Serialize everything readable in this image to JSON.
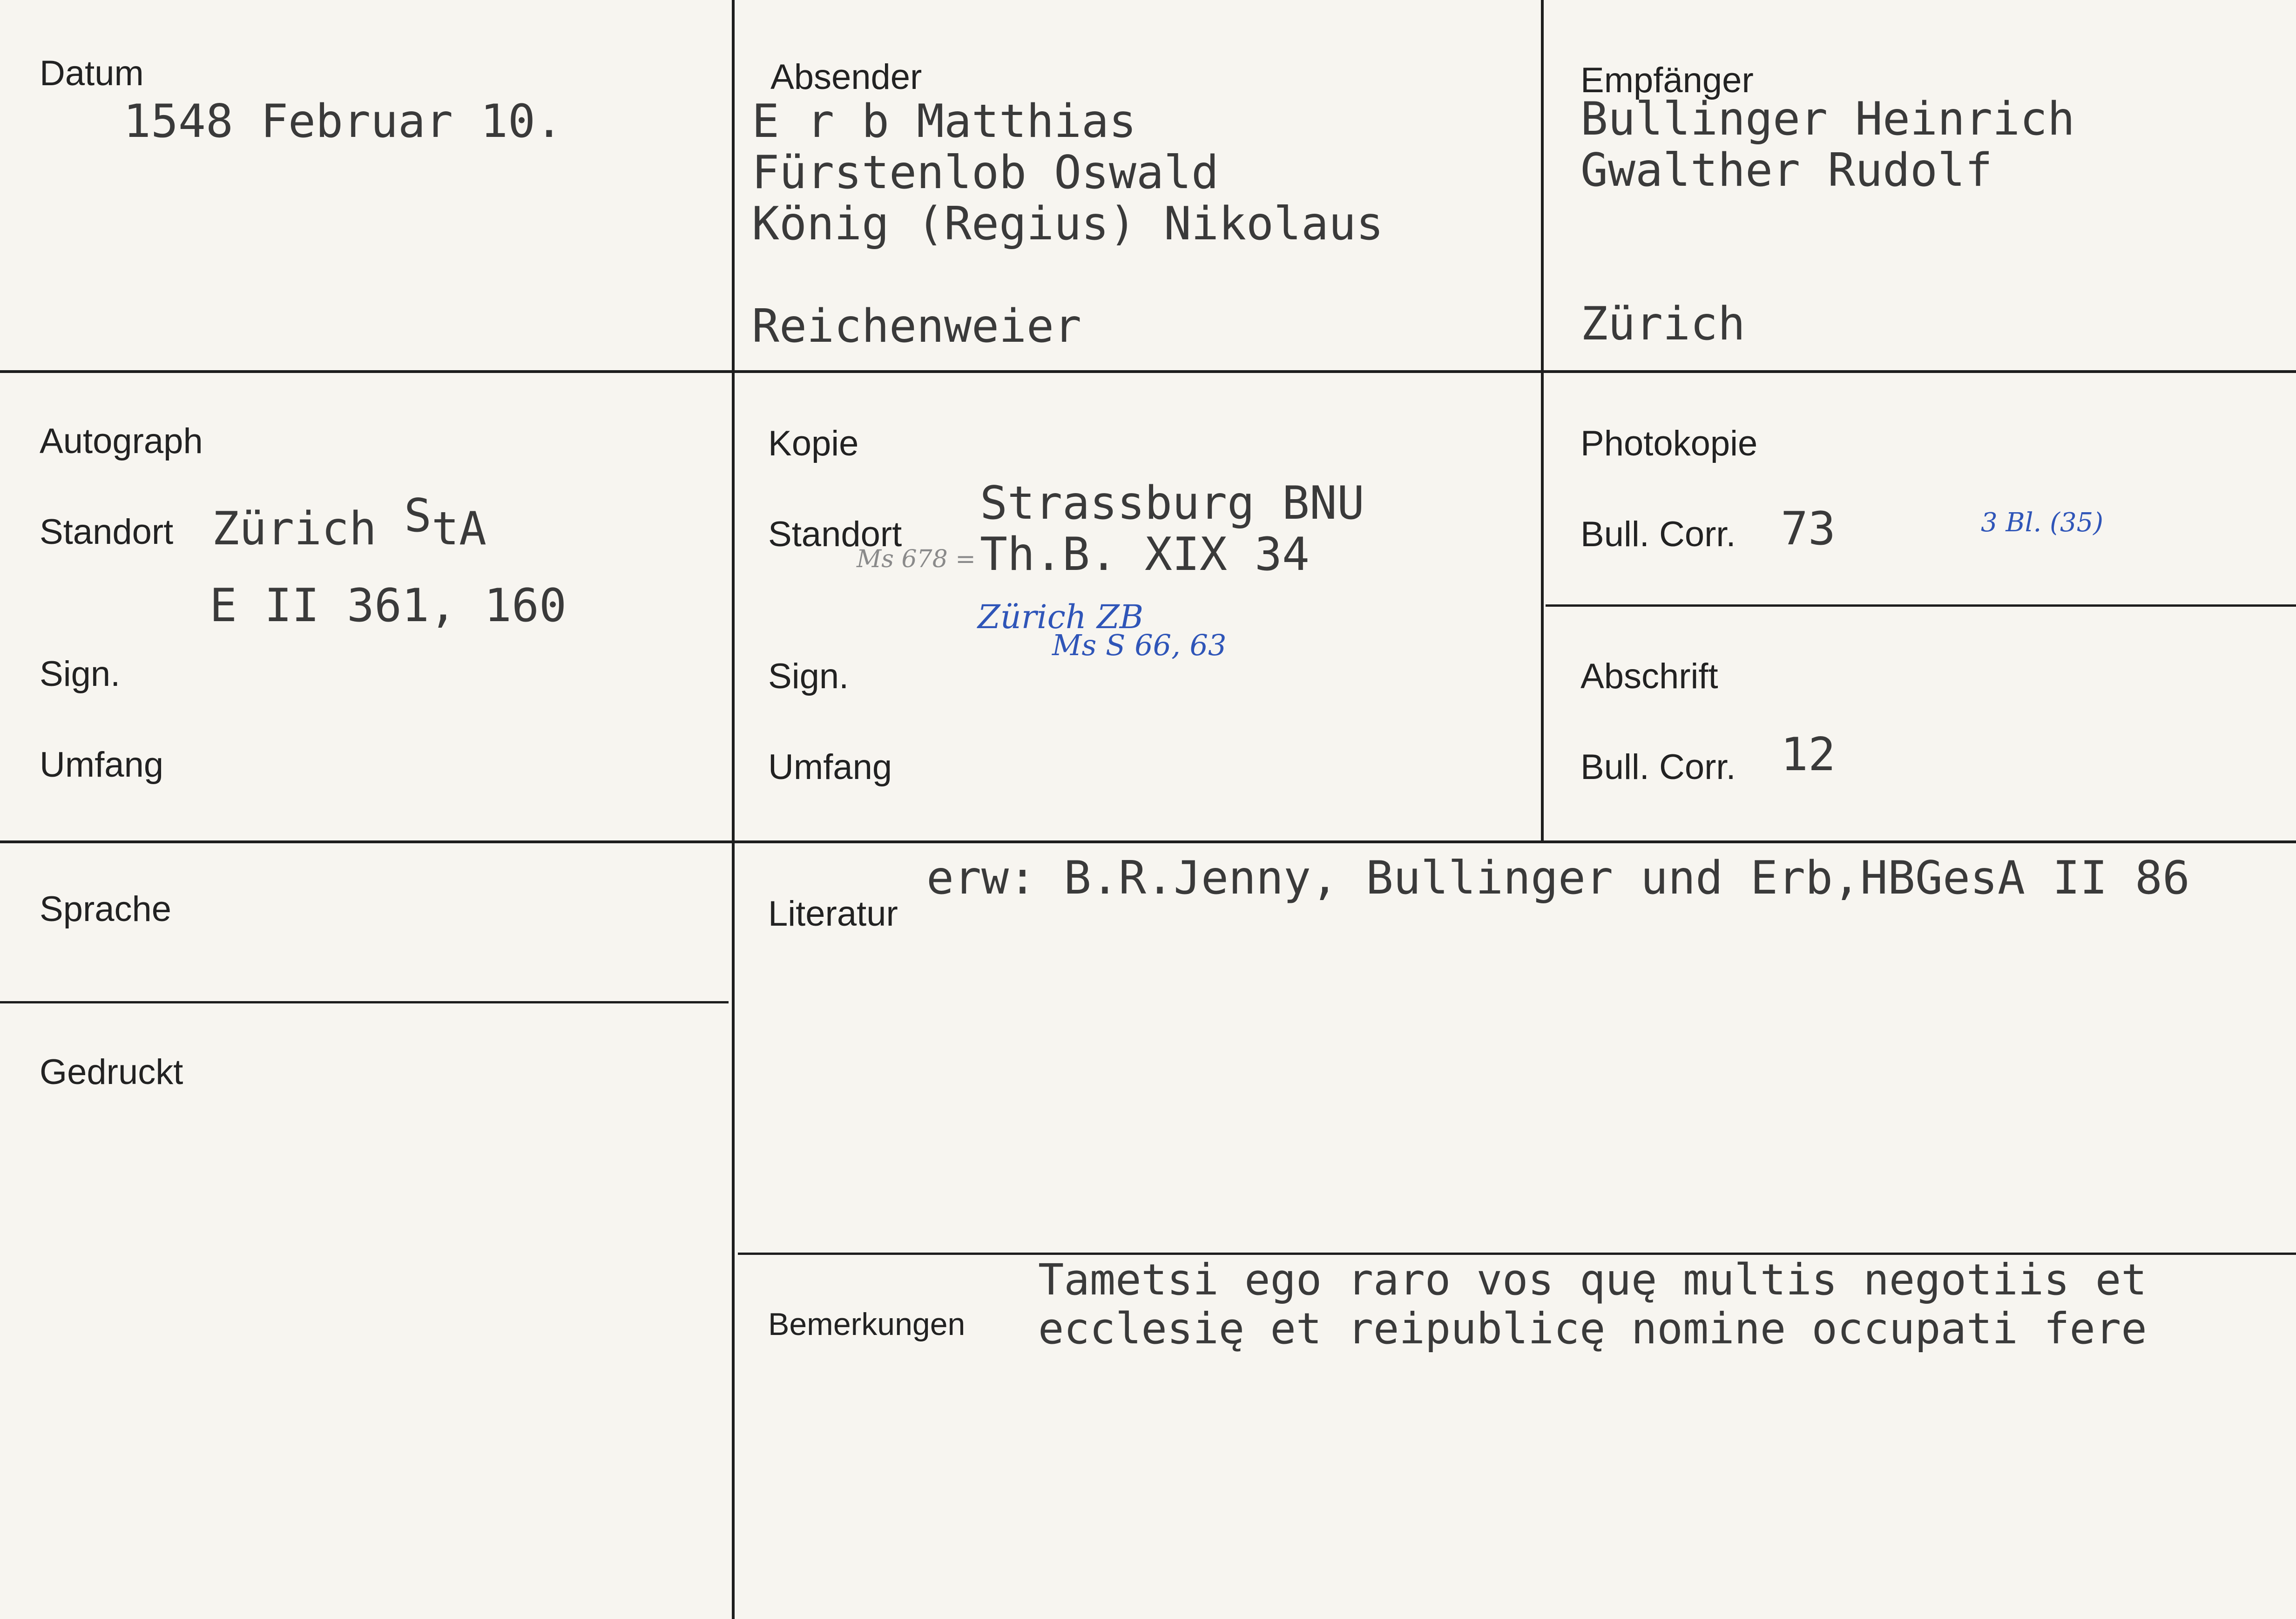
{
  "labels": {
    "datum": "Datum",
    "absender": "Absender",
    "empfaenger": "Empfänger",
    "autograph": "Autograph",
    "standort_a": "Standort",
    "sign_a": "Sign.",
    "umfang_a": "Umfang",
    "kopie": "Kopie",
    "standort_k": "Standort",
    "sign_k": "Sign.",
    "umfang_k": "Umfang",
    "photokopie": "Photokopie",
    "bullcorr_p": "Bull. Corr.",
    "abschrift": "Abschrift",
    "bullcorr_a": "Bull. Corr.",
    "sprache": "Sprache",
    "literatur": "Literatur",
    "gedruckt": "Gedruckt",
    "bemerkungen": "Bemerkungen"
  },
  "values": {
    "datum": "1548 Februar 10.",
    "absender": [
      "E r b  Matthias",
      "Fürstenlob Oswald",
      "König (Regius) Nikolaus"
    ],
    "absender_ort": "Reichenweier",
    "empfaenger": [
      "Bullinger Heinrich",
      "Gwalther Rudolf"
    ],
    "empfaenger_ort": "Zürich",
    "autograph_standort": "Zürich",
    "autograph_standort_sup": "S",
    "autograph_standort_suffix": "tA",
    "autograph_sign": "E II 361, 160",
    "kopie_standort_1": "Strassburg BNU",
    "kopie_standort_2": "Th.B. XIX 34",
    "photokopie_bullcorr": "73",
    "abschrift_bullcorr": "12",
    "literatur": "erw: B.R.Jenny, Bullinger und Erb,HBGesA II 86",
    "bemerkungen": [
      "Tametsi ego raro vos quę multis negotiis et",
      "ecclesię et reipublicę nomine occupati fere"
    ]
  },
  "annotations": {
    "kopie_ms": "Ms 678 =",
    "kopie_zurich_1": "Zürich ZB",
    "kopie_zurich_2": "Ms S 66, 63",
    "photokopie_note": "3 Bl. (35)"
  }
}
